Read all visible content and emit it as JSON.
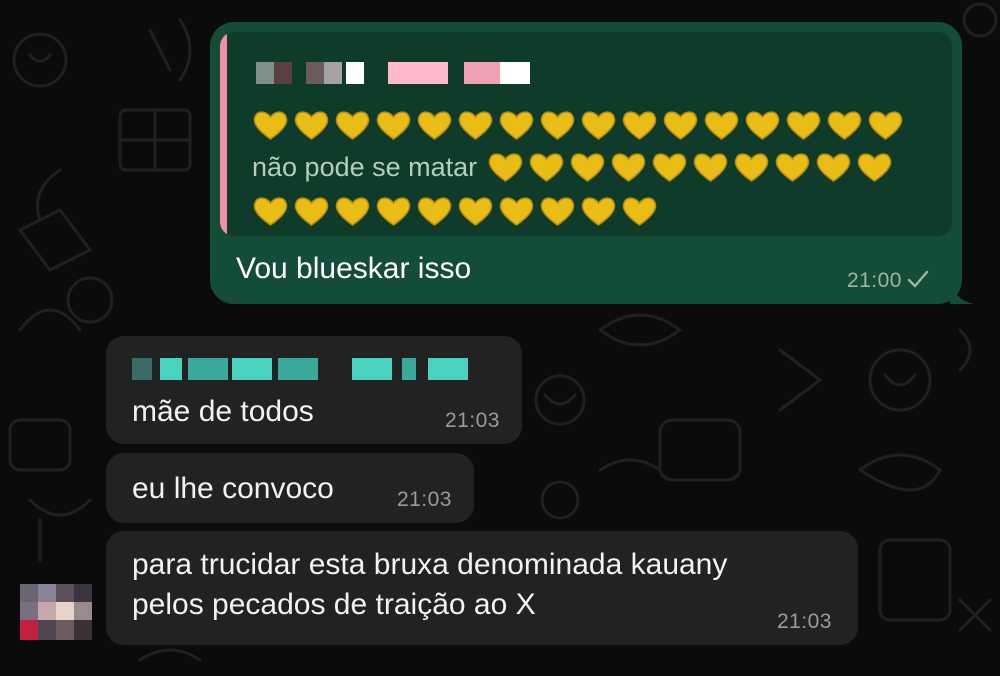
{
  "chat": {
    "outgoing": {
      "quoted_text": "não pode se matar",
      "hearts": "💛",
      "text": "Vou blueskar isso",
      "time": "21:00",
      "status_icon": "single-check-icon"
    },
    "incoming": [
      {
        "text": "mãe de todos",
        "time": "21:03"
      },
      {
        "text": "eu lhe convoco",
        "time": "21:03"
      },
      {
        "text_line1": "para trucidar esta bruxa denominada kauany",
        "text_line2": "pelos pecados de traição ao X",
        "time": "21:03"
      }
    ]
  },
  "colors": {
    "outgoing_bubble": "#144d37",
    "quote_bg": "#0f3b2a",
    "quote_bar": "#f28ea8",
    "incoming_bubble": "#212222",
    "heart": "#e9bd16"
  }
}
